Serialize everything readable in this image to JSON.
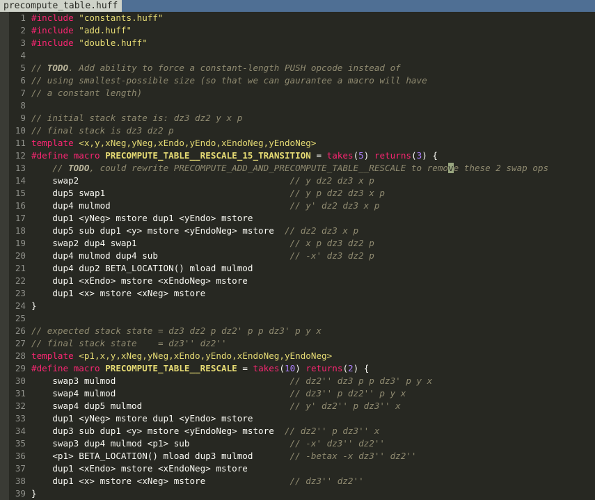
{
  "tab": {
    "title": "precompute_table.huff"
  },
  "lines": [
    [
      {
        "t": "#include",
        "c": "pp"
      },
      {
        "t": " "
      },
      {
        "t": "\"constants.huff\"",
        "c": "str"
      }
    ],
    [
      {
        "t": "#include",
        "c": "pp"
      },
      {
        "t": " "
      },
      {
        "t": "\"add.huff\"",
        "c": "str"
      }
    ],
    [
      {
        "t": "#include",
        "c": "pp"
      },
      {
        "t": " "
      },
      {
        "t": "\"double.huff\"",
        "c": "str"
      }
    ],
    [],
    [
      {
        "t": "// ",
        "c": "cm"
      },
      {
        "t": "TODO",
        "c": "cmb"
      },
      {
        "t": ". Add ability to force a constant-length PUSH opcode instead of",
        "c": "cm"
      }
    ],
    [
      {
        "t": "// using smallest-possible size (so that we can gaurantee a macro will have",
        "c": "cm"
      }
    ],
    [
      {
        "t": "// a constant length)",
        "c": "cm"
      }
    ],
    [],
    [
      {
        "t": "// initial stack state is: dz3 dz2 y x p",
        "c": "cm"
      }
    ],
    [
      {
        "t": "// final stack is dz3 dz2 p",
        "c": "cm"
      }
    ],
    [
      {
        "t": "template",
        "c": "kw"
      },
      {
        "t": " <x,y,xNeg,yNeg,xEndo,yEndo,xEndoNeg,yEndoNeg>",
        "c": "str"
      }
    ],
    [
      {
        "t": "#define",
        "c": "pp"
      },
      {
        "t": " "
      },
      {
        "t": "macro",
        "c": "kw"
      },
      {
        "t": " "
      },
      {
        "t": "PRECOMPUTE_TABLE__RESCALE_15_TRANSITION",
        "c": "tp"
      },
      {
        "t": " = "
      },
      {
        "t": "takes",
        "c": "kw"
      },
      {
        "t": "("
      },
      {
        "t": "5",
        "c": "num"
      },
      {
        "t": ") "
      },
      {
        "t": "returns",
        "c": "kw"
      },
      {
        "t": "("
      },
      {
        "t": "3",
        "c": "num"
      },
      {
        "t": ") {"
      }
    ],
    [
      {
        "t": "    // ",
        "c": "cm"
      },
      {
        "t": "TODO",
        "c": "cmb"
      },
      {
        "t": ", could rewrite PRECOMPUTE_ADD_AND_PRECOMPUTE_TABLE__RESCALE to remo",
        "c": "cm"
      },
      {
        "t": "v",
        "c": "caret"
      },
      {
        "t": "e these 2 swap ops",
        "c": "cm"
      }
    ],
    [
      {
        "t": "    swap2                                        "
      },
      {
        "t": "// y dz2 dz3 x p",
        "c": "cm"
      }
    ],
    [
      {
        "t": "    dup5 swap1                                   "
      },
      {
        "t": "// y p dz2 dz3 x p",
        "c": "cm"
      }
    ],
    [
      {
        "t": "    dup4 mulmod                                  "
      },
      {
        "t": "// y' dz2 dz3 x p",
        "c": "cm"
      }
    ],
    [
      {
        "t": "    dup1 <yNeg> mstore dup1 <yEndo> mstore"
      }
    ],
    [
      {
        "t": "    dup5 sub dup1 <y> mstore <yEndoNeg> mstore  "
      },
      {
        "t": "// dz2 dz3 x p",
        "c": "cm"
      }
    ],
    [
      {
        "t": "    swap2 dup4 swap1                             "
      },
      {
        "t": "// x p dz3 dz2 p",
        "c": "cm"
      }
    ],
    [
      {
        "t": "    dup4 mulmod dup4 sub                         "
      },
      {
        "t": "// -x' dz3 dz2 p",
        "c": "cm"
      }
    ],
    [
      {
        "t": "    dup4 dup2 BETA_LOCATION() mload mulmod"
      }
    ],
    [
      {
        "t": "    dup1 <xEndo> mstore <xEndoNeg> mstore"
      }
    ],
    [
      {
        "t": "    dup1 <x> mstore <xNeg> mstore"
      }
    ],
    [
      {
        "t": "}"
      }
    ],
    [],
    [
      {
        "t": "// expected stack state = dz3 dz2 p dz2' p p dz3' p y x",
        "c": "cm"
      }
    ],
    [
      {
        "t": "// final stack state    = dz3'' dz2''",
        "c": "cm"
      }
    ],
    [
      {
        "t": "template",
        "c": "kw"
      },
      {
        "t": " <p1,x,y,xNeg,yNeg,xEndo,yEndo,xEndoNeg,yEndoNeg>",
        "c": "str"
      }
    ],
    [
      {
        "t": "#define",
        "c": "pp"
      },
      {
        "t": " "
      },
      {
        "t": "macro",
        "c": "kw"
      },
      {
        "t": " "
      },
      {
        "t": "PRECOMPUTE_TABLE__RESCALE",
        "c": "tp"
      },
      {
        "t": " = "
      },
      {
        "t": "takes",
        "c": "kw"
      },
      {
        "t": "("
      },
      {
        "t": "10",
        "c": "num"
      },
      {
        "t": ") "
      },
      {
        "t": "returns",
        "c": "kw"
      },
      {
        "t": "("
      },
      {
        "t": "2",
        "c": "num"
      },
      {
        "t": ") {"
      }
    ],
    [
      {
        "t": "    swap3 mulmod                                 "
      },
      {
        "t": "// dz2'' dz3 p p dz3' p y x",
        "c": "cm"
      }
    ],
    [
      {
        "t": "    swap4 mulmod                                 "
      },
      {
        "t": "// dz3'' p dz2'' p y x",
        "c": "cm"
      }
    ],
    [
      {
        "t": "    swap4 dup5 mulmod                            "
      },
      {
        "t": "// y' dz2'' p dz3'' x",
        "c": "cm"
      }
    ],
    [
      {
        "t": "    dup1 <yNeg> mstore dup1 <yEndo> mstore"
      }
    ],
    [
      {
        "t": "    dup3 sub dup1 <y> mstore <yEndoNeg> mstore  "
      },
      {
        "t": "// dz2'' p dz3'' x",
        "c": "cm"
      }
    ],
    [
      {
        "t": "    swap3 dup4 mulmod <p1> sub                   "
      },
      {
        "t": "// -x' dz3'' dz2''",
        "c": "cm"
      }
    ],
    [
      {
        "t": "    <p1> BETA_LOCATION() mload dup3 mulmod       "
      },
      {
        "t": "// -betax -x dz3'' dz2''",
        "c": "cm"
      }
    ],
    [
      {
        "t": "    dup1 <xEndo> mstore <xEndoNeg> mstore"
      }
    ],
    [
      {
        "t": "    dup1 <x> mstore <xNeg> mstore                "
      },
      {
        "t": "// dz3'' dz2''",
        "c": "cm"
      }
    ],
    [
      {
        "t": "}"
      }
    ]
  ]
}
